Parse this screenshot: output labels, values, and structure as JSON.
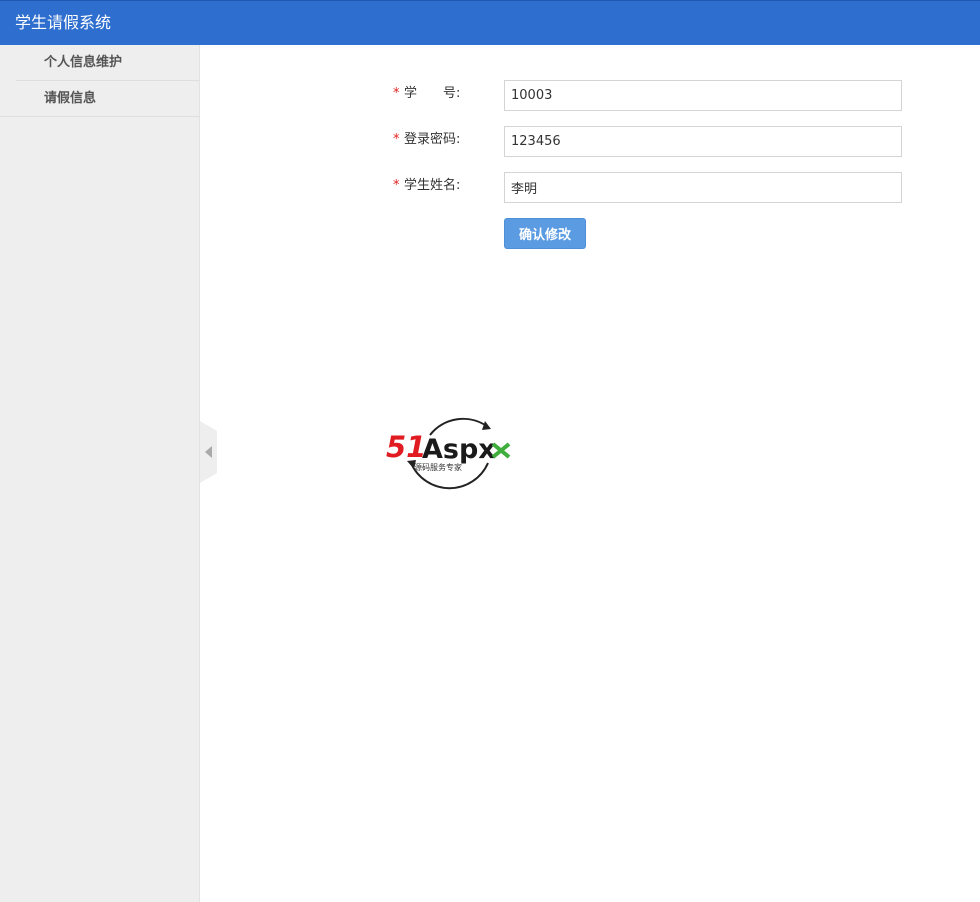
{
  "header": {
    "title": "学生请假系统"
  },
  "sidebar": {
    "items": [
      {
        "label": "个人信息维护"
      },
      {
        "label": "请假信息"
      }
    ]
  },
  "form": {
    "required_mark": "*",
    "fields": [
      {
        "label": "学　　号:",
        "value": "10003"
      },
      {
        "label": "登录密码:",
        "value": "123456"
      },
      {
        "label": "学生姓名:",
        "value": "李明"
      }
    ],
    "submit_label": "确认修改"
  },
  "logo": {
    "text_red": "51",
    "text_black": "Aspx",
    "tagline": "源码服务专家"
  },
  "colors": {
    "header_bg": "#2e6ece",
    "sidebar_bg": "#eeeeee",
    "button_bg": "#5b9be2",
    "required": "#e02020"
  }
}
